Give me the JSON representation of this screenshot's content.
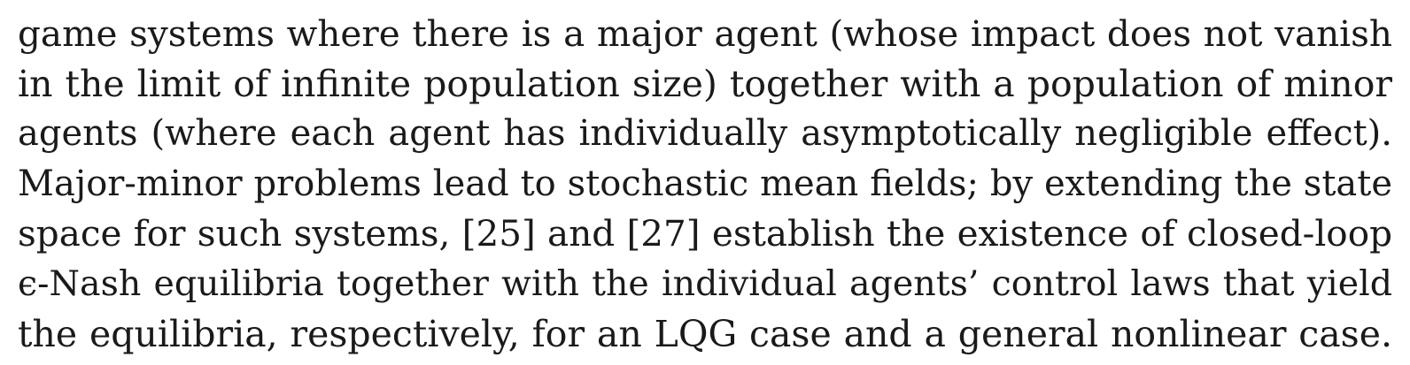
{
  "paragraph": {
    "lines": [
      "game systems where there is a major agent (whose impact does not vanish",
      "in the limit of infinite population size) together with a population of minor",
      "agents (where each agent has individually asymptotically negligible effect).",
      "Major-minor problems lead to stochastic mean fields; by extending the state",
      "space for such systems, [25] and [27] establish the existence of closed-loop",
      "ϵ-Nash equilibria together with the individual agents’ control laws that yield",
      "the equilibria, respectively, for an LQG case and a general nonlinear case."
    ]
  }
}
